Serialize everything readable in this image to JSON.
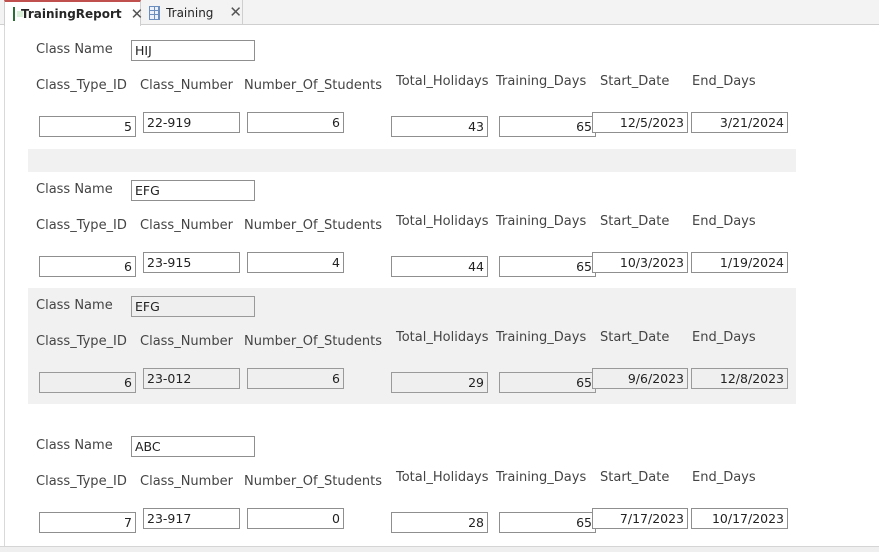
{
  "tabs": [
    {
      "label": "TrainingReport",
      "icon": "report-icon",
      "active": true
    },
    {
      "label": "Training",
      "icon": "table-icon",
      "active": false
    }
  ],
  "labels": {
    "class_name": "Class Name",
    "class_type_id": "Class_Type_ID",
    "class_number": "Class_Number",
    "number_of_students": "Number_Of_Students",
    "total_holidays": "Total_Holidays",
    "training_days": "Training_Days",
    "start_date": "Start_Date",
    "end_days": "End_Days"
  },
  "records": [
    {
      "class_name": "HIJ",
      "class_type_id": "5",
      "class_number": "22-919",
      "number_of_students": "6",
      "total_holidays": "43",
      "training_days": "65",
      "start_date": "12/5/2023",
      "end_days": "3/21/2024"
    },
    {
      "class_name": "EFG",
      "class_type_id": "6",
      "class_number": "23-915",
      "number_of_students": "4",
      "total_holidays": "44",
      "training_days": "65",
      "start_date": "10/3/2023",
      "end_days": "1/19/2024"
    },
    {
      "class_name": "EFG",
      "class_type_id": "6",
      "class_number": "23-012",
      "number_of_students": "6",
      "total_holidays": "29",
      "training_days": "65",
      "start_date": "9/6/2023",
      "end_days": "12/8/2023"
    },
    {
      "class_name": "ABC",
      "class_type_id": "7",
      "class_number": "23-917",
      "number_of_students": "0",
      "total_holidays": "28",
      "training_days": "65",
      "start_date": "7/17/2023",
      "end_days": "10/17/2023"
    }
  ],
  "colors": {
    "active_tab_accent": "#c0504d",
    "shaded_band": "#f1f1f1"
  }
}
